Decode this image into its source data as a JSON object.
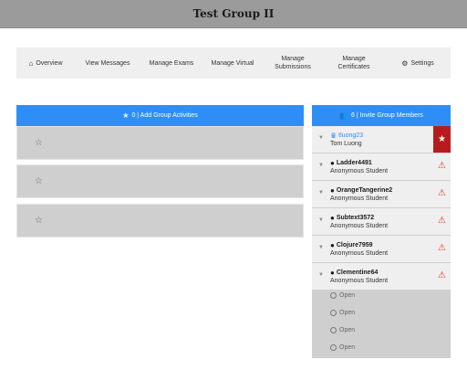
{
  "header": {
    "title": "Test Group II"
  },
  "nav": [
    {
      "label": "Overview",
      "icon": "home-icon"
    },
    {
      "label": "View Messages"
    },
    {
      "label": "Manage Exams"
    },
    {
      "label": "Manage Virtual"
    },
    {
      "label": "Manage Submissions"
    },
    {
      "label": "Manage Certificates"
    },
    {
      "label": "Settings",
      "icon": "gear-icon"
    }
  ],
  "activities": {
    "header_label": "0 | Add Group Activities",
    "icon": "star-icon",
    "slots": 3
  },
  "members": {
    "header_label": "6 | Invite Group Members",
    "icon": "users-icon",
    "list": [
      {
        "username": "tluong23",
        "name": "Tom Luong",
        "role": "owner"
      },
      {
        "username": "Ladder4491",
        "name": "Anonymous Student"
      },
      {
        "username": "OrangeTangerine2",
        "name": "Anonymous Student"
      },
      {
        "username": "Subtext3572",
        "name": "Anonymous Student"
      },
      {
        "username": "Clojure7959",
        "name": "Anonymous Student"
      },
      {
        "username": "Clementine64",
        "name": "Anonymous Student"
      }
    ],
    "open_slots": [
      "Open",
      "Open",
      "Open",
      "Open"
    ]
  },
  "colors": {
    "accent": "#2f8ef5",
    "owner_badge": "#b71c1c",
    "warning": "#e0392b"
  }
}
